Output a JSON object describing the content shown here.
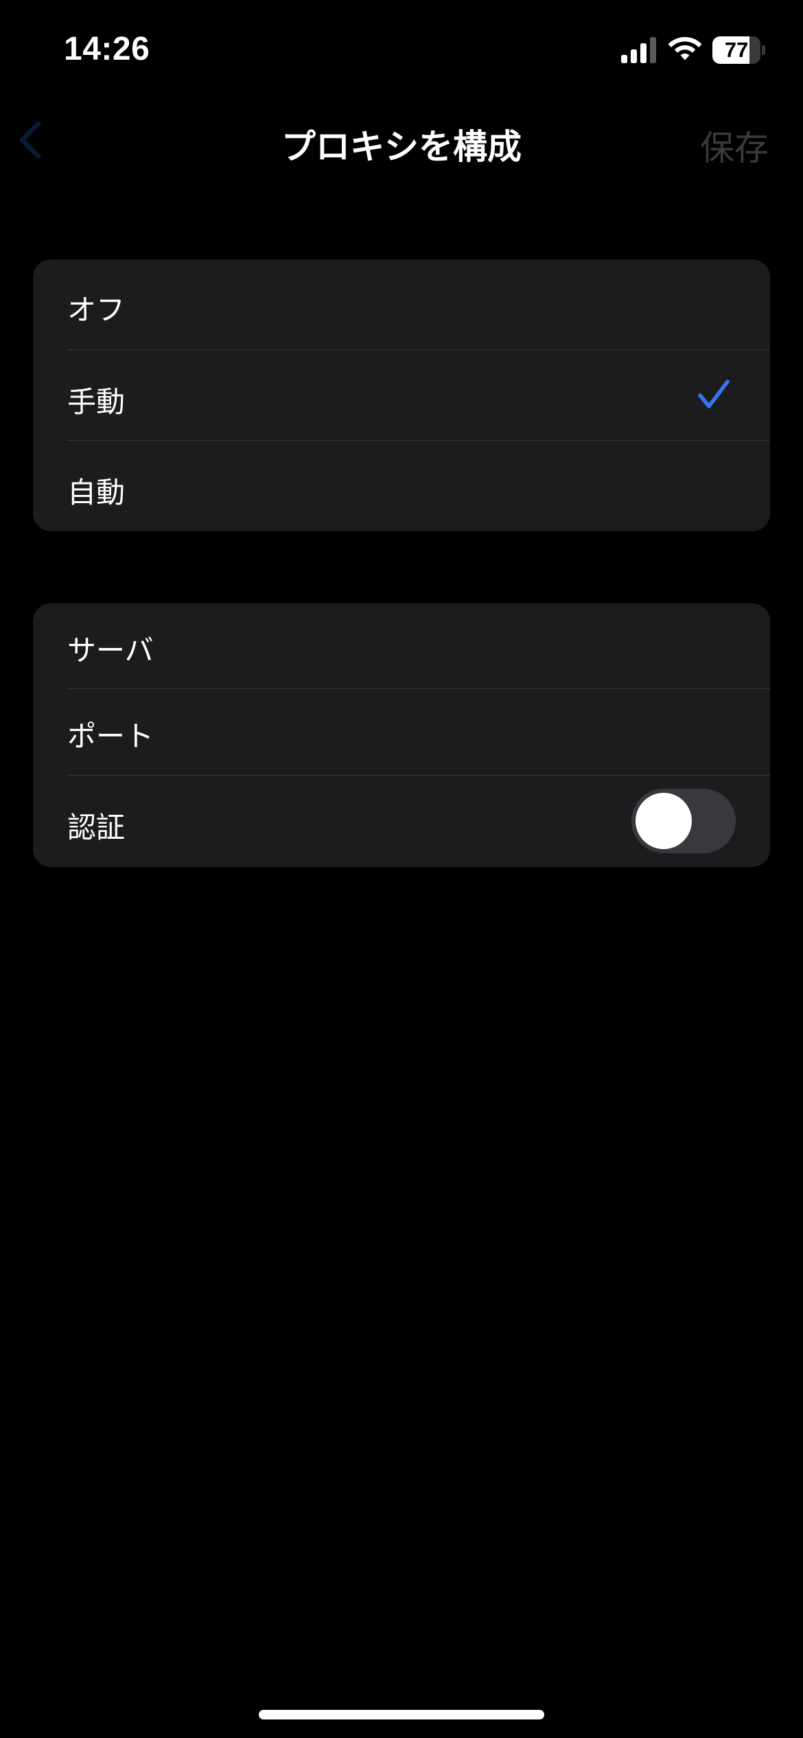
{
  "status_bar": {
    "time": "14:26",
    "battery_level": "77",
    "battery_fraction": 0.77,
    "icons": [
      "cellular-signal-icon",
      "wifi-icon",
      "battery-icon"
    ]
  },
  "nav": {
    "title": "プロキシを構成",
    "save_label": "保存",
    "back_icon": "chevron-left-icon"
  },
  "proxy_modes": {
    "selected": "手動",
    "items": [
      {
        "label": "オフ",
        "selected": false
      },
      {
        "label": "手動",
        "selected": true
      },
      {
        "label": "自動",
        "selected": false
      }
    ]
  },
  "proxy_settings": {
    "server_label": "サーバ",
    "port_label": "ポート",
    "auth_label": "認証",
    "auth_enabled": false
  },
  "colors": {
    "background": "#000000",
    "group_background": "#1c1c1e",
    "separator": "#38383a",
    "accent": "#3478f6",
    "disabled_text": "#3a3a3c",
    "toggle_off": "#39393d"
  }
}
